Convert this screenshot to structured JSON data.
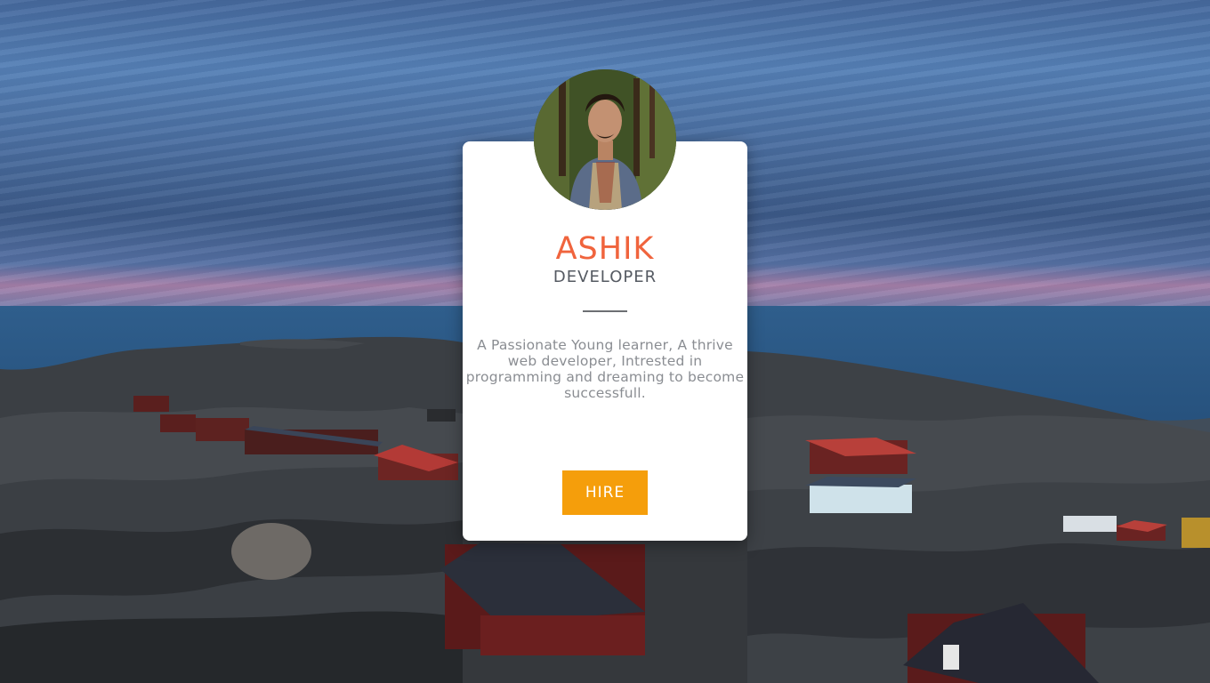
{
  "profile": {
    "name": "ASHIK",
    "role": "DEVELOPER",
    "bio": "A Passionate Young learner, A thrive web developer, Intrested in programming and dreaming to become successfull.",
    "hire_label": "HIRE"
  },
  "colors": {
    "name": "#f0643d",
    "hire_button": "#f59e0b",
    "card": "#ffffff"
  }
}
